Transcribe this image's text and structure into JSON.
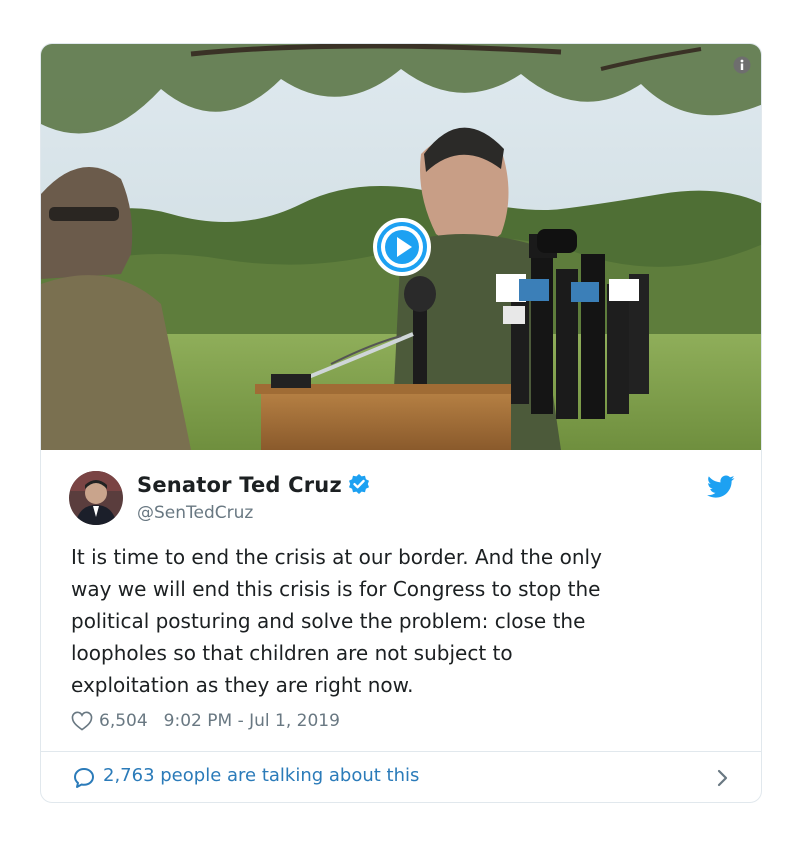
{
  "tweet": {
    "display_name": "Senator Ted Cruz",
    "handle": "@SenTedCruz",
    "text": "It is time to end the crisis at our border. And the only\nway we will end this crisis is for Congress to stop the\npolitical posturing and solve the problem: close the\nloopholes so that children are not subject to\nexploitation as they are right now.",
    "likes": "6,504",
    "timestamp": "9:02 PM - Jul 1, 2019",
    "talking": "2,763 people are talking about this"
  },
  "icons": {
    "info": "info-icon",
    "play": "play-icon",
    "verified": "verified-badge-icon",
    "brand": "twitter-bird-icon",
    "like": "heart-icon",
    "conversation": "speech-bubble-icon",
    "chevron": "chevron-right-icon"
  },
  "colors": {
    "link_blue": "#2b7bb9",
    "twitter_blue": "#1da1f2",
    "secondary_text": "#697882",
    "border": "#e1e8ed"
  }
}
